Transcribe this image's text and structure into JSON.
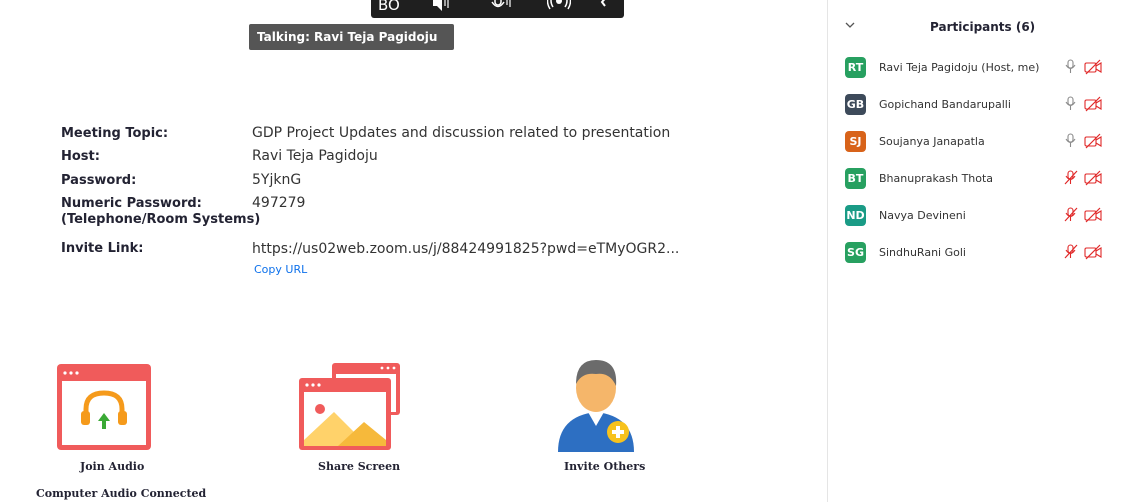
{
  "toolbar": {
    "bo_label": "BO"
  },
  "talking": "Talking: Ravi Teja Pagidoju",
  "meeting": {
    "topic_label": "Meeting Topic:",
    "topic_value": "GDP Project Updates and discussion related to presentation",
    "host_label": "Host:",
    "host_value": "Ravi Teja Pagidoju",
    "password_label": "Password:",
    "password_value": "5YjknG",
    "numeric_password_label_1": "Numeric Password:",
    "numeric_password_label_2": "(Telephone/Room Systems)",
    "numeric_password_value": "497279",
    "invite_label": "Invite Link:",
    "invite_value": "https://us02web.zoom.us/j/88424991825?pwd=eTMyOGR2...",
    "copy_url": "Copy URL"
  },
  "actions": {
    "join_audio": "Join Audio",
    "share_screen": "Share Screen",
    "invite_others": "Invite Others",
    "audio_status": "Computer Audio Connected"
  },
  "participants": {
    "title": "Participants (6)",
    "list": [
      {
        "initials": "RT",
        "name": "Ravi Teja Pagidoju (Host, me)",
        "color": "#27a060",
        "muted": false
      },
      {
        "initials": "GB",
        "name": "Gopichand Bandarupalli",
        "color": "#3d4a5a",
        "muted": false
      },
      {
        "initials": "SJ",
        "name": "Soujanya Janapatla",
        "color": "#d8631a",
        "muted": false
      },
      {
        "initials": "BT",
        "name": "Bhanuprakash Thota",
        "color": "#27a060",
        "muted": true
      },
      {
        "initials": "ND",
        "name": "Navya Devineni",
        "color": "#1a9b86",
        "muted": true
      },
      {
        "initials": "SG",
        "name": "SindhuRani Goli",
        "color": "#27a060",
        "muted": true
      }
    ]
  },
  "colors": {
    "accent": "#0e71eb",
    "muted_red": "#e02828",
    "tile_red": "#f05b5b"
  }
}
